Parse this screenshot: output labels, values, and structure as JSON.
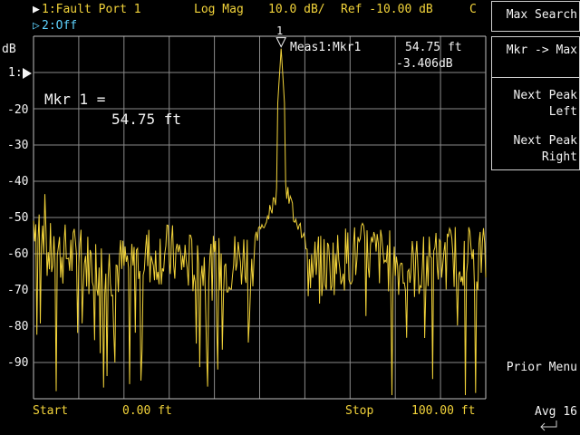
{
  "header": {
    "trace1_marker": "▶",
    "trace1_label": "1:Fault Port 1",
    "format": "Log Mag",
    "scale": "10.0 dB/",
    "ref": "Ref -10.00 dB",
    "cal_flag": "C",
    "trace2_marker": "▷",
    "trace2_label": "2:Off"
  },
  "axis": {
    "unit": "dB",
    "ref_position_label": "1:",
    "tick_labels": [
      "-20",
      "-30",
      "-40",
      "-50",
      "-60",
      "-70",
      "-80",
      "-90"
    ]
  },
  "marker": {
    "number": "1",
    "readout_label": "Meas1:Mkr1",
    "readout_x": "54.75 ft",
    "readout_y": "-3.406dB",
    "big_label": "Mkr 1 =",
    "big_value": "54.75 ft"
  },
  "footer": {
    "start_label": "Start",
    "start_value": "0.00 ft",
    "stop_label": "Stop",
    "stop_value": "100.00 ft"
  },
  "softkeys": {
    "max_search": "Max Search",
    "mkr_max": "Mkr -> Max",
    "next_peak_left_1": "Next Peak",
    "next_peak_left_2": "Left",
    "next_peak_right_1": "Next Peak",
    "next_peak_right_2": "Right",
    "prior_menu": "Prior Menu",
    "avg": "Avg 16"
  },
  "colors": {
    "trace": "#f2d33a",
    "grid": "#8a8a8a",
    "text_yellow": "#f2d33a",
    "text_cyan": "#5fd3ff"
  },
  "chart_data": {
    "type": "line",
    "x_range": [
      0,
      100
    ],
    "y_range": [
      -100,
      0
    ],
    "grid": true,
    "marker_x": 54.75,
    "marker_y": -3.406
  }
}
